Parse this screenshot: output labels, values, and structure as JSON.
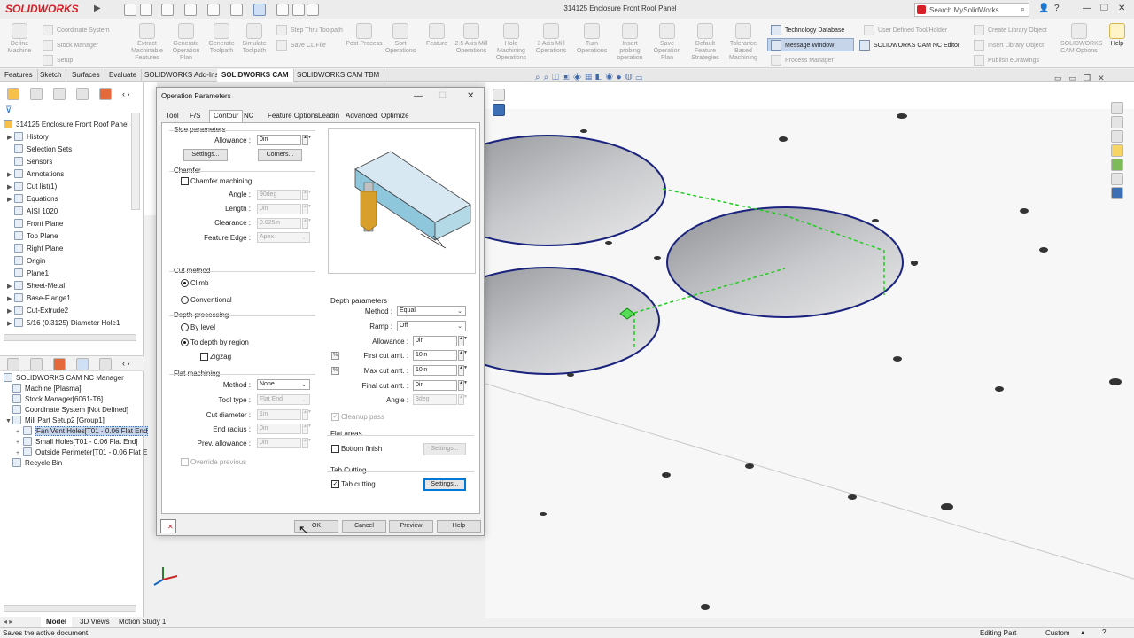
{
  "app": {
    "logo": "SOLIDWORKS",
    "document_title": "314125 Enclosure Front Roof Panel",
    "search_placeholder": "Search MySolidWorks"
  },
  "ribbon": {
    "buttons": [
      {
        "label": "Define Machine"
      },
      {
        "label": "Extract Machinable Features"
      },
      {
        "label": "Generate Operation Plan"
      },
      {
        "label": "Generate Toolpath"
      },
      {
        "label": "Simulate Toolpath"
      },
      {
        "label": "Post Process"
      },
      {
        "label": "Sort Operations"
      },
      {
        "label": "Feature"
      },
      {
        "label": "2.5 Axis Mill Operations"
      },
      {
        "label": "Hole Machining Operations"
      },
      {
        "label": "3 Axis Mill Operations"
      },
      {
        "label": "Turn Operations"
      },
      {
        "label": "Insert probing operation"
      },
      {
        "label": "Save Operation Plan"
      },
      {
        "label": "Default Feature Strategies"
      },
      {
        "label": "Tolerance Based Machining"
      }
    ],
    "small_col1": [
      "Coordinate System",
      "Stock Manager",
      "Setup"
    ],
    "small_col2": [
      "Step Thru Toolpath",
      "Save CL File"
    ],
    "active_col": [
      "Technology Database",
      "Message Window",
      "Process Manager"
    ],
    "nc_editor": "SOLIDWORKS CAM NC Editor",
    "right_col1": [
      "User Defined Tool/Holder"
    ],
    "right_col2": [
      "Create Library Object",
      "Insert Library Object",
      "Publish eDrawings"
    ],
    "options": "SOLIDWORKS CAM Options",
    "help": "Help"
  },
  "command_tabs": [
    "Features",
    "Sketch",
    "Surfaces",
    "Evaluate",
    "SOLIDWORKS Add-Ins",
    "SOLIDWORKS CAM",
    "SOLIDWORKS CAM TBM"
  ],
  "feature_tree": {
    "root": "314125 Enclosure Front Roof Panel  (D",
    "items": [
      "History",
      "Selection Sets",
      "Sensors",
      "Annotations",
      "Cut list(1)",
      "Equations",
      "AISI 1020",
      "Front Plane",
      "Top Plane",
      "Right Plane",
      "Origin",
      "Plane1",
      "Sheet-Metal",
      "Base-Flange1",
      "Cut-Extrude2",
      "5/16 (0.3125) Diameter Hole1"
    ]
  },
  "cam_tree": {
    "items": [
      "SOLIDWORKS CAM NC Manager",
      "Machine [Plasma]",
      "Stock Manager[6061-T6]",
      "Coordinate System [Not Defined]",
      "Mill Part Setup2 [Group1]",
      "Fan Vent Holes[T01 - 0.06 Flat End",
      "Small Holes[T01 - 0.06 Flat End]",
      "Outside Perimeter[T01 - 0.06 Flat E",
      "Recycle Bin"
    ]
  },
  "dialog": {
    "title": "Operation Parameters",
    "tabs": [
      "Tool",
      "F/S",
      "Contour",
      "NC",
      "Feature Options",
      "Leadin",
      "Advanced",
      "Optimize"
    ],
    "side_params": {
      "title": "Side parameters",
      "allowance_label": "Allowance :",
      "allowance_value": "0in",
      "settings_btn": "Settings...",
      "corners_btn": "Corners..."
    },
    "chamfer": {
      "title": "Chamfer",
      "checkbox": "Chamfer machining",
      "angle_label": "Angle :",
      "angle_value": "90deg",
      "length_label": "Length :",
      "length_value": "0in",
      "clearance_label": "Clearance :",
      "clearance_value": "0.025in",
      "edge_label": "Feature Edge :",
      "edge_value": "Apex"
    },
    "cut_method": {
      "title": "Cut method",
      "climb": "Climb",
      "conventional": "Conventional"
    },
    "depth_processing": {
      "title": "Depth processing",
      "by_level": "By level",
      "to_depth": "To depth by region",
      "zigzag": "Zigzag"
    },
    "flat_machining": {
      "title": "Flat machining",
      "method_label": "Method :",
      "method_value": "None",
      "tool_type_label": "Tool type :",
      "tool_type_value": "Flat End",
      "cut_diameter_label": "Cut diameter :",
      "cut_diameter_value": "1in",
      "end_radius_label": "End radius :",
      "end_radius_value": "0in",
      "prev_allowance_label": "Prev. allowance :",
      "prev_allowance_value": "0in",
      "override": "Override previous"
    },
    "depth_params": {
      "title": "Depth parameters",
      "method_label": "Method :",
      "method_value": "Equal",
      "ramp_label": "Ramp :",
      "ramp_value": "Off",
      "allowance_label": "Allowance :",
      "allowance_value": "0in",
      "first_cut_label": "First cut amt. :",
      "first_cut_value": "10in",
      "max_cut_label": "Max cut amt. :",
      "max_cut_value": "10in",
      "final_cut_label": "Final cut amt. :",
      "final_cut_value": "0in",
      "angle_label": "Angle :",
      "angle_value": "3deg",
      "cleanup": "Cleanup pass"
    },
    "flat_areas": {
      "title": "Flat areas",
      "bottom_finish": "Bottom finish",
      "settings_btn": "Settings..."
    },
    "tab_cutting": {
      "title": "Tab Cutting",
      "checkbox": "Tab cutting",
      "settings_btn": "Settings..."
    },
    "buttons": {
      "ok": "OK",
      "cancel": "Cancel",
      "preview": "Preview",
      "help": "Help"
    }
  },
  "bottom_tabs": [
    "Model",
    "3D Views",
    "Motion Study 1"
  ],
  "status": {
    "left": "Saves the active document.",
    "mode": "Editing Part",
    "units": "Custom"
  },
  "colors": {
    "accent": "#0078d7",
    "brand": "#d61f26",
    "selection": "#c7d5ea",
    "toolpath": "#22cc22",
    "hole_outline": "#1a237e"
  }
}
